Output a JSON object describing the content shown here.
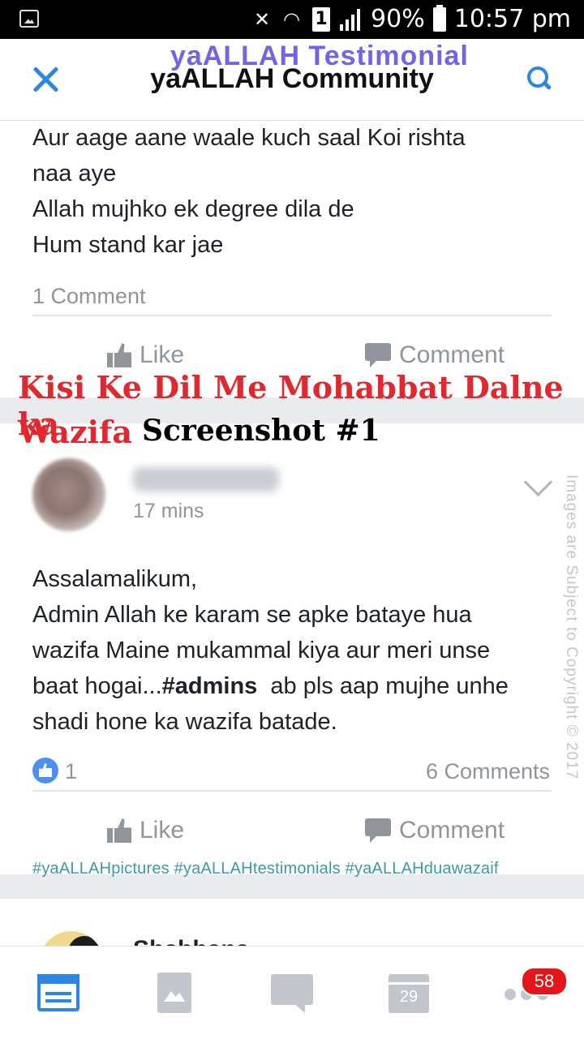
{
  "status_bar": {
    "battery": "90%",
    "time": "10:57 pm",
    "sim_slot": "1"
  },
  "header": {
    "title": "yaALLAH Community",
    "overlay_title": "yaALLAH Testimonial"
  },
  "post_prev": {
    "lines": [
      "Aur aage aane waale kuch saal Koi rishta",
      "naa aye",
      "Allah mujhko ek degree dila de",
      "Hum stand kar jae"
    ],
    "comments": "1 Comment",
    "like_label": "Like",
    "comment_label": "Comment"
  },
  "overlay": {
    "red_line1": "Kisi Ke Dil Me Mohabbat Dalne ka",
    "red_line2": "Wazifa",
    "black": "Screenshot #1"
  },
  "post_main": {
    "time": "17 mins",
    "text_pre": "Assalamalikum,\nAdmin Allah ke karam se apke bataye hua\nwazifa Maine mukammal kiya aur meri unse\nbaat hogai...",
    "mention": "#admins",
    "text_post": "  ab pls aap mujhe unhe",
    "last_line": "shadi hone ka wazifa batade.",
    "reactions": "1",
    "comments": "6 Comments",
    "like_label": "Like",
    "comment_label": "Comment"
  },
  "watermark": "Images are Subject to Copyright © 2017",
  "hashtags": "#yaALLAHpictures #yaALLAHtestimonials #yaALLAHduawazaif",
  "next_post": {
    "name": "Shabbana Kh..."
  },
  "nav": {
    "calendar_day": "29",
    "notif_count": "58"
  },
  "icons": [
    "close-icon",
    "search-icon",
    "like-icon",
    "comment-icon",
    "chevron-down-icon",
    "news-feed-icon",
    "photos-icon",
    "messages-icon",
    "calendar-icon",
    "more-icon"
  ]
}
